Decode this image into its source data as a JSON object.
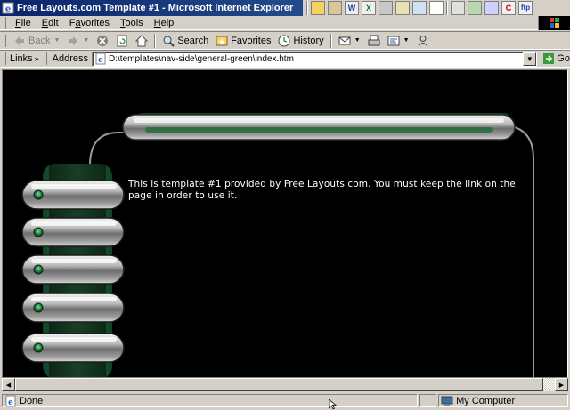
{
  "window": {
    "title": "Free Layouts.com Template #1 - Microsoft Internet Explorer",
    "tray_icons": [
      "folder-icon",
      "book-icon",
      "word-icon",
      "excel-icon",
      "calculator-icon",
      "search-icon",
      "magnifier-icon",
      "document-icon",
      "printer-icon",
      "network-icon",
      "tools-icon",
      "c-app-icon",
      "ftp-icon"
    ],
    "tray_labels": {
      "word": "W",
      "excel": "X",
      "c_app": "C",
      "ftp": "ftp"
    }
  },
  "menu": {
    "items": [
      {
        "key": "F",
        "rest": "ile"
      },
      {
        "key": "E",
        "rest": "dit"
      },
      {
        "pre": "F",
        "key": "a",
        "rest": "vorites",
        "label": "Favorites"
      },
      {
        "key": "T",
        "rest": "ools"
      },
      {
        "key": "H",
        "rest": "elp"
      }
    ]
  },
  "toolbar": {
    "back_label": "Back",
    "search_label": "Search",
    "favorites_label": "Favorites",
    "history_label": "History"
  },
  "addressbar": {
    "links_label": "Links",
    "links_chevron": "»",
    "address_label": "Address",
    "address_value": "D:\\templates\\nav-side\\general-green\\index.htm",
    "go_label": "Go"
  },
  "page": {
    "body_text": "This is template #1 provided by Free Layouts.com. You must keep the link on the page in order to use it.",
    "nav_buttons": [
      "",
      "",
      "",
      "",
      ""
    ],
    "accent_color": "#1f6b3a",
    "background_color": "#000000"
  },
  "statusbar": {
    "status_text": "Done",
    "zone_text": "My Computer"
  }
}
